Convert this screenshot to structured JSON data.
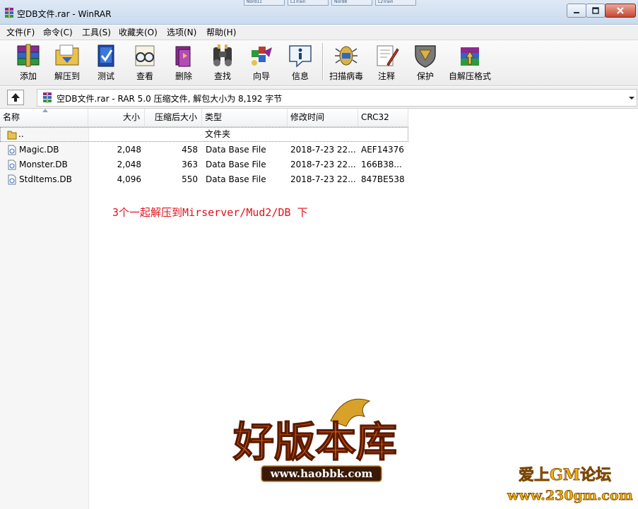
{
  "window": {
    "title": "空DB文件.rar - WinRAR",
    "buttons": [
      "minimize",
      "maximize",
      "close"
    ]
  },
  "background_tabs": [
    "Nord11",
    "L1Train",
    "Nord8",
    "L2Train"
  ],
  "menu": [
    {
      "label": "文件(F)"
    },
    {
      "label": "命令(C)"
    },
    {
      "label": "工具(S)"
    },
    {
      "label": "收藏夹(O)"
    },
    {
      "label": "选项(N)"
    },
    {
      "label": "帮助(H)"
    }
  ],
  "toolbar": [
    {
      "label": "添加",
      "icon": "add-books-icon"
    },
    {
      "label": "解压到",
      "icon": "extract-folder-icon"
    },
    {
      "label": "测试",
      "icon": "test-check-icon"
    },
    {
      "label": "查看",
      "icon": "view-glasses-icon"
    },
    {
      "label": "删除",
      "icon": "delete-icon"
    },
    {
      "label": "查找",
      "icon": "find-binoculars-icon"
    },
    {
      "label": "向导",
      "icon": "wizard-icon"
    },
    {
      "label": "信息",
      "icon": "info-icon"
    },
    {
      "label": "扫描病毒",
      "icon": "scan-virus-icon"
    },
    {
      "label": "注释",
      "icon": "comment-pen-icon"
    },
    {
      "label": "保护",
      "icon": "protect-shield-icon"
    },
    {
      "label": "自解压格式",
      "icon": "sfx-box-icon"
    }
  ],
  "address": {
    "text": "空DB文件.rar - RAR 5.0 压缩文件, 解包大小为 8,192 字节"
  },
  "columns": {
    "name": "名称",
    "size": "大小",
    "packed": "压缩后大小",
    "type": "类型",
    "modified": "修改时间",
    "crc": "CRC32"
  },
  "files": [
    {
      "name": "..",
      "size": "",
      "packed": "",
      "type": "文件夹",
      "modified": "",
      "crc": "",
      "kind": "folder"
    },
    {
      "name": "Magic.DB",
      "size": "2,048",
      "packed": "458",
      "type": "Data Base File",
      "modified": "2018-7-23 22...",
      "crc": "AEF14376",
      "kind": "file"
    },
    {
      "name": "Monster.DB",
      "size": "2,048",
      "packed": "363",
      "type": "Data Base File",
      "modified": "2018-7-23 22...",
      "crc": "166B38...",
      "kind": "file"
    },
    {
      "name": "StdItems.DB",
      "size": "4,096",
      "packed": "550",
      "type": "Data Base File",
      "modified": "2018-7-23 22...",
      "crc": "847BE538",
      "kind": "file"
    }
  ],
  "note": "3个一起解压到Mirserver/Mud2/DB 下",
  "watermarks": {
    "main_logo_text": "好版本库",
    "main_logo_url": "www.haobbk.com",
    "corner_logo_text": "爱上GM论坛",
    "corner_logo_url": "www.230gm.com"
  },
  "colors": {
    "note": "#e0121c",
    "titlebar": "#c9dbee",
    "logo_orange": "#e35d0c"
  }
}
